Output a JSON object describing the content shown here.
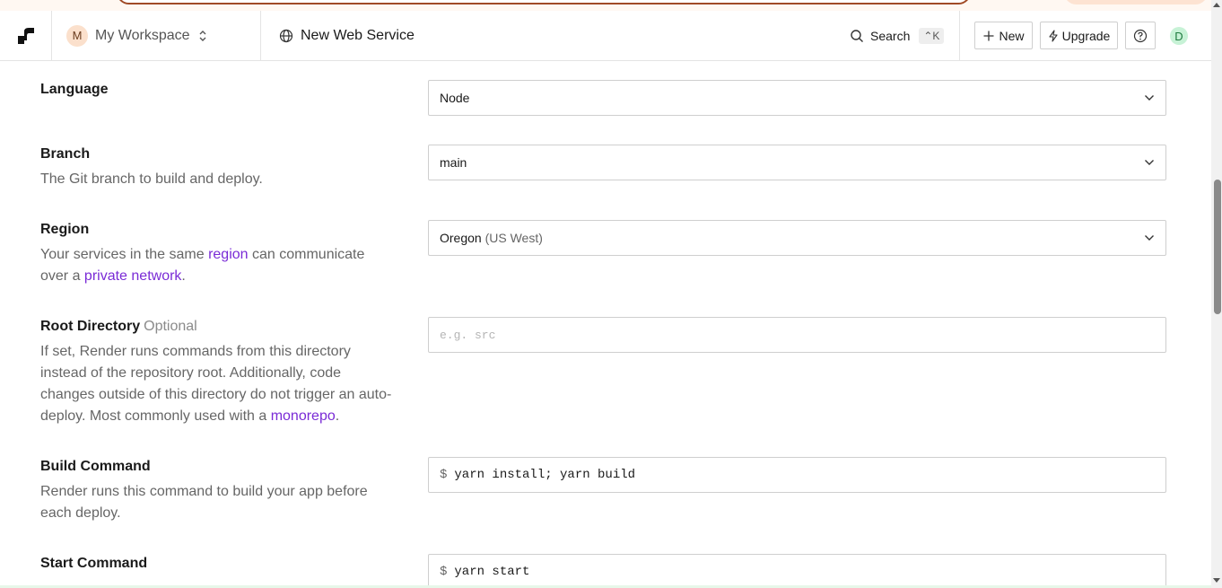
{
  "header": {
    "workspace_initial": "M",
    "workspace_name": "My Workspace",
    "breadcrumb": "New Web Service",
    "search_label": "Search",
    "search_shortcut": "⌃K",
    "new_label": "New",
    "upgrade_label": "Upgrade",
    "user_initial": "D"
  },
  "form": {
    "language": {
      "title": "Language",
      "value": "Node"
    },
    "branch": {
      "title": "Branch",
      "desc": "The Git branch to build and deploy.",
      "value": "main"
    },
    "region": {
      "title": "Region",
      "desc_pre": "Your services in the same ",
      "desc_link1": "region",
      "desc_mid": " can communicate over a ",
      "desc_link2": "private network",
      "desc_post": ".",
      "value_main": "Oregon",
      "value_sub": "(US West)"
    },
    "root_directory": {
      "title": "Root Directory",
      "optional": "Optional",
      "desc_pre": "If set, Render runs commands from this directory instead of the repository root. Additionally, code changes outside of this directory do not trigger an auto-deploy. Most commonly used with a ",
      "desc_link": "monorepo",
      "desc_post": ".",
      "placeholder": "e.g. src"
    },
    "build_command": {
      "title": "Build Command",
      "desc": "Render runs this command to build your app before each deploy.",
      "prefix": "$",
      "value": "yarn install; yarn build"
    },
    "start_command": {
      "title": "Start Command",
      "prefix": "$",
      "value": "yarn start"
    }
  },
  "icons": [
    "render-logo-icon",
    "chevron-up-down-icon",
    "globe-icon",
    "search-icon",
    "plus-icon",
    "lightning-icon",
    "help-icon",
    "chevron-down-icon"
  ],
  "colors": {
    "link": "#7a2bd6",
    "banner_border": "#a04a26"
  }
}
